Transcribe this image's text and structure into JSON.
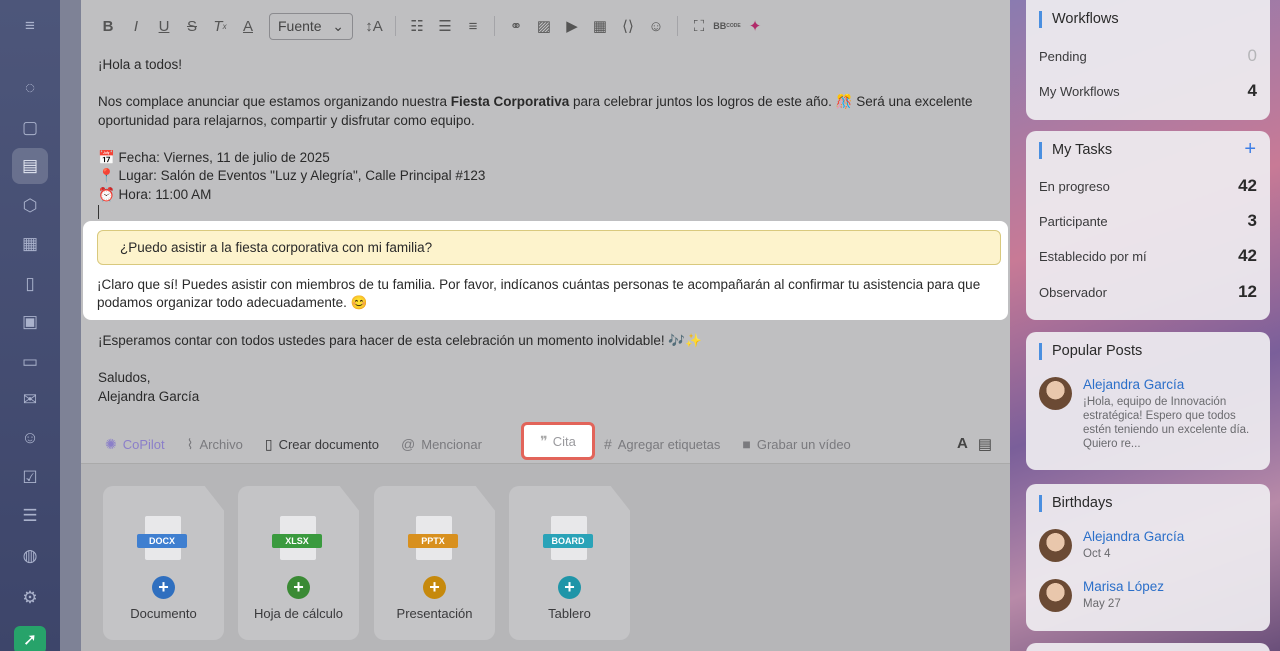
{
  "toolbar": {
    "font_select": "Fuente",
    "code_label": "BB",
    "code_sub": "CODE"
  },
  "message": {
    "greeting": "¡Hola a todos!",
    "intro_before": "Nos complace anunciar que estamos organizando nuestra ",
    "intro_bold": "Fiesta Corporativa",
    "intro_after": " para celebrar juntos los logros de este año. 🎊 Será una excelente",
    "intro_line2": "oportunidad para relajarnos, compartir y disfrutar como equipo.",
    "date_line": "📅 Fecha: Viernes, 11 de julio de 2025",
    "place_line": "📍 Lugar: Salón de Eventos \"Luz y Alegría\", Calle Principal #123",
    "time_line": "⏰ Hora: 11:00 AM",
    "quote": "¿Puedo asistir a la fiesta corporativa con mi familia?",
    "answer": "¡Claro que sí! Puedes asistir con miembros de tu familia. Por favor, indícanos cuántas personas te acompañarán al confirmar tu asistencia para que podamos organizar todo adecuadamente. 😊",
    "closing": "¡Esperamos contar con todos ustedes para hacer de esta celebración un momento inolvidable! 🎶✨",
    "regards": "Saludos,",
    "signature": "Alejandra García"
  },
  "actions": {
    "copilot": "CoPilot",
    "archivo": "Archivo",
    "crear_documento": "Crear documento",
    "mencionar": "Mencionar",
    "cita": "Cita",
    "agregar_etiquetas": "Agregar etiquetas",
    "grabar_video": "Grabar un vídeo",
    "font_toggle": "A"
  },
  "docs": [
    {
      "tag": "DOCX",
      "label": "Documento",
      "tag_color": "#3f7fd0",
      "plus_color": "#2f6fbf"
    },
    {
      "tag": "XLSX",
      "label": "Hoja de cálculo",
      "tag_color": "#3a9a3e",
      "plus_color": "#3a8a34"
    },
    {
      "tag": "PPTX",
      "label": "Presentación",
      "tag_color": "#d8901e",
      "plus_color": "#c6890c"
    },
    {
      "tag": "BOARD",
      "label": "Tablero",
      "tag_color": "#2aa3b8",
      "plus_color": "#1f95a8"
    }
  ],
  "sidebar": {
    "workflows": {
      "title": "Workflows",
      "rows": [
        {
          "label": "Pending",
          "value": "0"
        },
        {
          "label": "My Workflows",
          "value": "4"
        }
      ]
    },
    "tasks": {
      "title": "My Tasks",
      "add": "+",
      "rows": [
        {
          "label": "En progreso",
          "value": "42"
        },
        {
          "label": "Participante",
          "value": "3"
        },
        {
          "label": "Establecido por mí",
          "value": "42"
        },
        {
          "label": "Observador",
          "value": "12"
        }
      ]
    },
    "popular": {
      "title": "Popular Posts",
      "name": "Alejandra García",
      "text": "¡Hola, equipo de Innovación estratégica! Espero que todos estén teniendo un excelente día. Quiero re..."
    },
    "birthdays": {
      "title": "Birthdays",
      "people": [
        {
          "name": "Alejandra García",
          "date": "Oct 4"
        },
        {
          "name": "Marisa López",
          "date": "May 27"
        }
      ]
    }
  },
  "colors": {
    "accent": "#4a8fe0",
    "cita_border": "#e2645a",
    "quote_bg": "#fdf3cc"
  }
}
